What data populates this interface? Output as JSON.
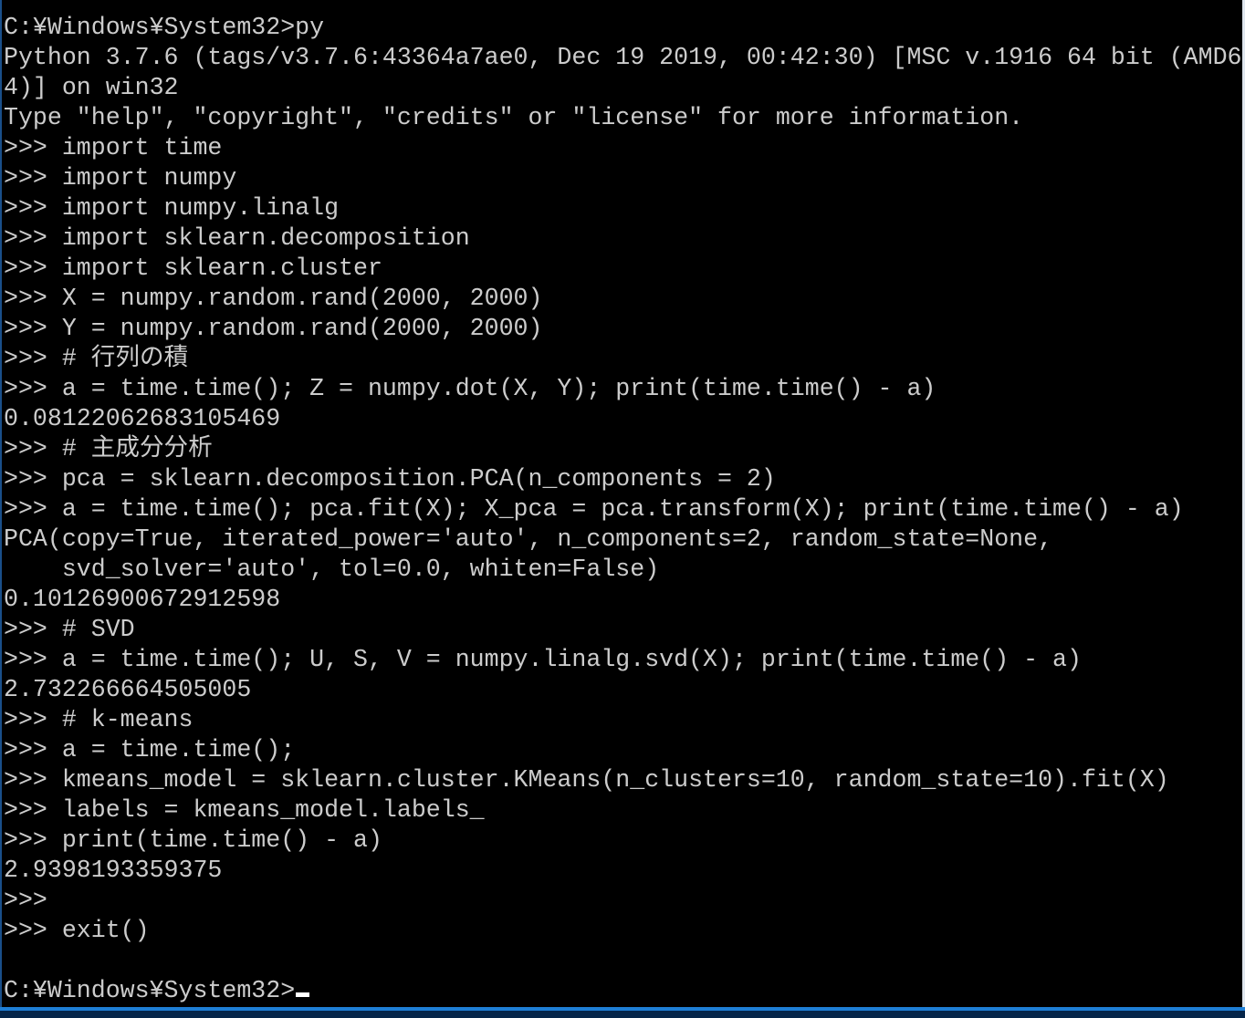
{
  "console": {
    "lines": [
      "C:¥Windows¥System32>py",
      "Python 3.7.6 (tags/v3.7.6:43364a7ae0, Dec 19 2019, 00:42:30) [MSC v.1916 64 bit (AMD6",
      "4)] on win32",
      "Type ″help″, ″copyright″, ″credits″ or ″license″ for more information.",
      ">>> import time",
      ">>> import numpy",
      ">>> import numpy.linalg",
      ">>> import sklearn.decomposition",
      ">>> import sklearn.cluster",
      ">>> X = numpy.random.rand(2000, 2000)",
      ">>> Y = numpy.random.rand(2000, 2000)",
      ">>> # 行列の積",
      ">>> a = time.time(); Z = numpy.dot(X, Y); print(time.time() - a)",
      "0.08122062683105469",
      ">>> # 主成分分析",
      ">>> pca = sklearn.decomposition.PCA(n_components = 2)",
      ">>> a = time.time(); pca.fit(X); X_pca = pca.transform(X); print(time.time() - a)",
      "PCA(copy=True, iterated_power='auto', n_components=2, random_state=None,",
      "    svd_solver='auto', tol=0.0, whiten=False)",
      "0.10126900672912598",
      ">>> # SVD",
      ">>> a = time.time(); U, S, V = numpy.linalg.svd(X); print(time.time() - a)",
      "2.732266664505005",
      ">>> # k-means",
      ">>> a = time.time();",
      ">>> kmeans_model = sklearn.cluster.KMeans(n_clusters=10, random_state=10).fit(X)",
      ">>> labels = kmeans_model.labels_",
      ">>> print(time.time() - a)",
      "2.9398193359375",
      ">>>",
      ">>> exit()",
      "",
      "C:¥Windows¥System32>"
    ]
  },
  "colors": {
    "text": "#cccccc",
    "background": "#000000",
    "accent": "#1e7fd6"
  }
}
